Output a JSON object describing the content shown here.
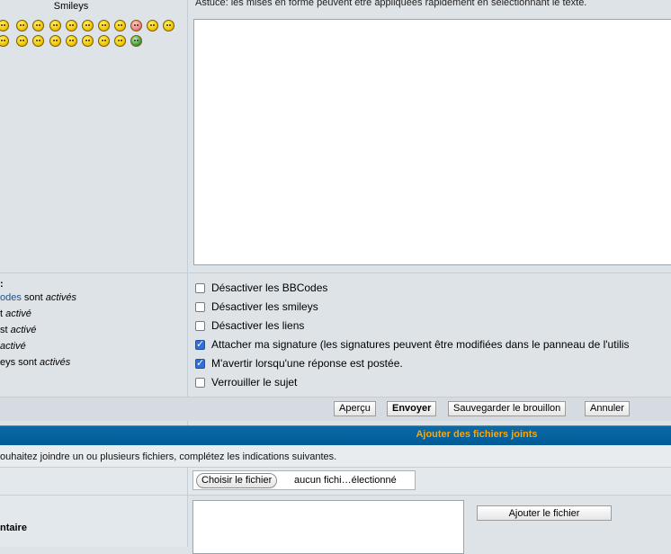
{
  "smileys": {
    "title": "Smileys",
    "row1": [
      "smile",
      "wink",
      "eek",
      "surprised",
      "cool",
      "confused",
      "lol",
      "pink",
      "neutral",
      "evil"
    ],
    "row2": [
      "twisted",
      "exclaim",
      "question",
      "idea",
      "arrow",
      "neutral2",
      "green"
    ]
  },
  "editor": {
    "tip": "Astuce: les mises en forme peuvent être appliquées rapidement en sélectionnant le texte."
  },
  "status": {
    "heading": ":",
    "lines": [
      {
        "pre": "odes",
        "mid": " sont ",
        "val": "activés",
        "link": true
      },
      {
        "pre": "t ",
        "mid": "",
        "val": "activé",
        "link": false
      },
      {
        "pre": "st ",
        "mid": "",
        "val": "activé",
        "link": false
      },
      {
        "pre": "",
        "mid": "",
        "val": "activé",
        "link": false
      },
      {
        "pre": "eys sont ",
        "mid": "",
        "val": "activés",
        "link": false
      }
    ]
  },
  "options": [
    {
      "label": "Désactiver les BBCodes",
      "checked": false
    },
    {
      "label": "Désactiver les smileys",
      "checked": false
    },
    {
      "label": "Désactiver les liens",
      "checked": false
    },
    {
      "label": "Attacher ma signature (les signatures peuvent être modifiées dans le panneau de l'utilis",
      "checked": true
    },
    {
      "label": "M'avertir lorsqu'une réponse est postée.",
      "checked": true
    },
    {
      "label": "Verrouiller le sujet",
      "checked": false
    }
  ],
  "buttons": {
    "preview": "Aperçu",
    "submit": "Envoyer",
    "save_draft": "Sauvegarder le brouillon",
    "cancel": "Annuler"
  },
  "attachments": {
    "title": "Ajouter des fichiers joints",
    "info": "ouhaitez joindre un ou plusieurs fichiers, complétez les indications suivantes.",
    "choose_button": "Choisir le fichier",
    "file_status": "aucun fichi…électionné",
    "comment_label": "ntaire",
    "add_button": "Ajouter le fichier"
  }
}
